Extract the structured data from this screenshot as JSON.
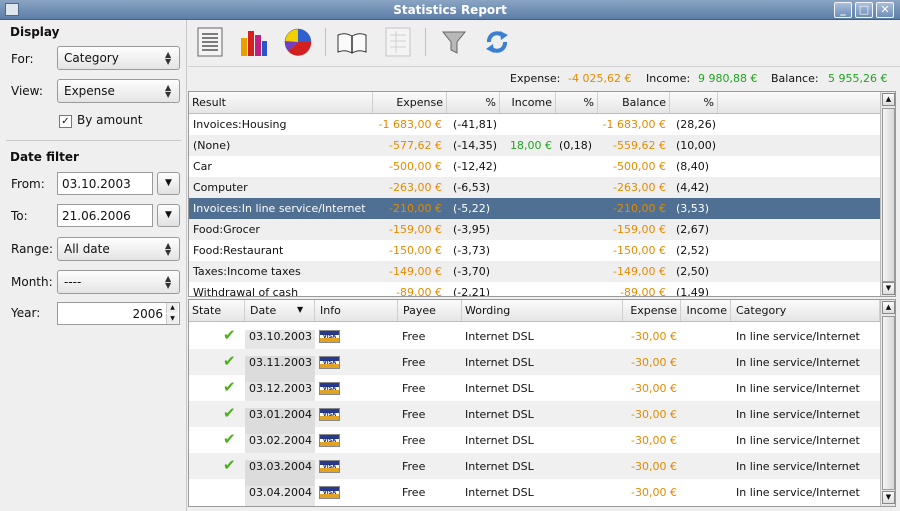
{
  "window": {
    "title": "Statistics Report"
  },
  "left": {
    "display_title": "Display",
    "for_label": "For:",
    "for_value": "Category",
    "view_label": "View:",
    "view_value": "Expense",
    "by_amount_label": "By amount",
    "by_amount_checked": true,
    "date_filter_title": "Date filter",
    "from_label": "From:",
    "from_value": "03.10.2003",
    "to_label": "To:",
    "to_value": "21.06.2006",
    "range_label": "Range:",
    "range_value": "All date",
    "month_label": "Month:",
    "month_value": "----",
    "year_label": "Year:",
    "year_value": "2006"
  },
  "toolbar": {
    "icons": [
      "list-report-icon",
      "bar-chart-icon",
      "pie-chart-icon",
      "book-icon",
      "grid-report-icon",
      "filter-icon",
      "refresh-icon"
    ]
  },
  "summary": {
    "expense_label": "Expense:",
    "expense_value": "-4 025,62 €",
    "income_label": "Income:",
    "income_value": "9 980,88 €",
    "balance_label": "Balance:",
    "balance_value": "5 955,26 €"
  },
  "colors": {
    "negative": "#e38b00",
    "positive": "#1fa51f",
    "selected_row": "#4f6f93"
  },
  "top_table": {
    "columns": [
      "Result",
      "Expense",
      "%",
      "Income",
      "%",
      "Balance",
      "%"
    ],
    "rows": [
      {
        "result": "Invoices:Housing",
        "expense": "-1 683,00 €",
        "expense_pct": "(-41,81)",
        "income": "",
        "income_pct": "",
        "balance": "-1 683,00 €",
        "balance_pct": "(28,26)"
      },
      {
        "result": "(None)",
        "expense": "-577,62 €",
        "expense_pct": "(-14,35)",
        "income": "18,00 €",
        "income_pct": "(0,18)",
        "balance": "-559,62 €",
        "balance_pct": "(10,00)"
      },
      {
        "result": "Car",
        "expense": "-500,00 €",
        "expense_pct": "(-12,42)",
        "income": "",
        "income_pct": "",
        "balance": "-500,00 €",
        "balance_pct": "(8,40)"
      },
      {
        "result": "Computer",
        "expense": "-263,00 €",
        "expense_pct": "(-6,53)",
        "income": "",
        "income_pct": "",
        "balance": "-263,00 €",
        "balance_pct": "(4,42)"
      },
      {
        "result": "Invoices:In line service/Internet",
        "expense": "-210,00 €",
        "expense_pct": "(-5,22)",
        "income": "",
        "income_pct": "",
        "balance": "-210,00 €",
        "balance_pct": "(3,53)"
      },
      {
        "result": "Food:Grocer",
        "expense": "-159,00 €",
        "expense_pct": "(-3,95)",
        "income": "",
        "income_pct": "",
        "balance": "-159,00 €",
        "balance_pct": "(2,67)"
      },
      {
        "result": "Food:Restaurant",
        "expense": "-150,00 €",
        "expense_pct": "(-3,73)",
        "income": "",
        "income_pct": "",
        "balance": "-150,00 €",
        "balance_pct": "(2,52)"
      },
      {
        "result": "Taxes:Income taxes",
        "expense": "-149,00 €",
        "expense_pct": "(-3,70)",
        "income": "",
        "income_pct": "",
        "balance": "-149,00 €",
        "balance_pct": "(2,50)"
      },
      {
        "result": "Withdrawal of cash",
        "expense": "-89,00 €",
        "expense_pct": "(-2,21)",
        "income": "",
        "income_pct": "",
        "balance": "-89,00 €",
        "balance_pct": "(1,49)"
      }
    ]
  },
  "bottom_table": {
    "columns": [
      "State",
      "Date",
      "Info",
      "Payee",
      "Wording",
      "Expense",
      "Income",
      "Category"
    ],
    "card_label": "VISA",
    "rows": [
      {
        "reconciled": true,
        "date": "03.10.2003",
        "payee": "Free",
        "wording": "Internet DSL",
        "expense": "-30,00 €",
        "income": "",
        "category": "In line service/Internet"
      },
      {
        "reconciled": true,
        "date": "03.11.2003",
        "payee": "Free",
        "wording": "Internet DSL",
        "expense": "-30,00 €",
        "income": "",
        "category": "In line service/Internet"
      },
      {
        "reconciled": true,
        "date": "03.12.2003",
        "payee": "Free",
        "wording": "Internet DSL",
        "expense": "-30,00 €",
        "income": "",
        "category": "In line service/Internet"
      },
      {
        "reconciled": true,
        "date": "03.01.2004",
        "payee": "Free",
        "wording": "Internet DSL",
        "expense": "-30,00 €",
        "income": "",
        "category": "In line service/Internet"
      },
      {
        "reconciled": true,
        "date": "03.02.2004",
        "payee": "Free",
        "wording": "Internet DSL",
        "expense": "-30,00 €",
        "income": "",
        "category": "In line service/Internet"
      },
      {
        "reconciled": true,
        "date": "03.03.2004",
        "payee": "Free",
        "wording": "Internet DSL",
        "expense": "-30,00 €",
        "income": "",
        "category": "In line service/Internet"
      },
      {
        "reconciled": false,
        "date": "03.04.2004",
        "payee": "Free",
        "wording": "Internet DSL",
        "expense": "-30,00 €",
        "income": "",
        "category": "In line service/Internet"
      }
    ]
  }
}
